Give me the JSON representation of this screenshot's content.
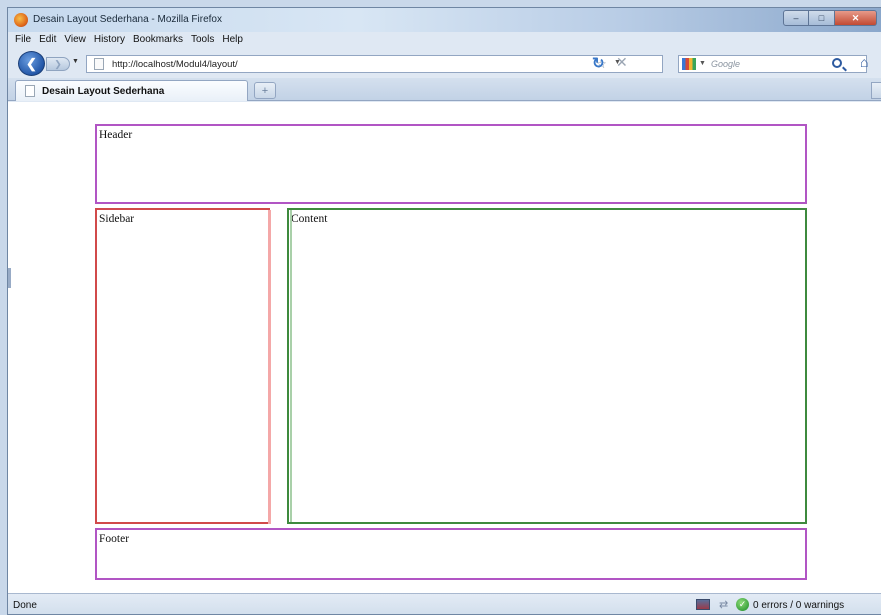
{
  "window": {
    "title": "Desain Layout Sederhana - Mozilla Firefox"
  },
  "menubar": {
    "items": [
      "File",
      "Edit",
      "View",
      "History",
      "Bookmarks",
      "Tools",
      "Help"
    ]
  },
  "navbar": {
    "url": "http://localhost/Modul4/layout/",
    "search_placeholder": "Google"
  },
  "tabs": [
    {
      "label": "Desain Layout Sederhana",
      "active": true
    }
  ],
  "page": {
    "header": "Header",
    "sidebar": "Sidebar",
    "content": "Content",
    "footer": "Footer"
  },
  "statusbar": {
    "status": "Done",
    "validator": "0 errors / 0 warnings"
  },
  "colors": {
    "header_border": "#b155c4",
    "sidebar_border": "#d14a4a",
    "content_border": "#3e8a3e",
    "footer_border": "#b155c4"
  }
}
